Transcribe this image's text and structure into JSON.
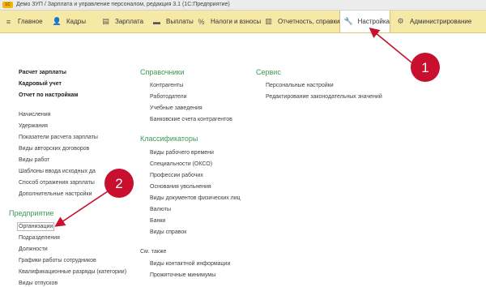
{
  "window": {
    "title": "Демо ЗУП / Зарплата и управление персоналом, редакция 3.1  (1С:Предприятие)",
    "logo": "1С"
  },
  "sections": [
    {
      "label": "Главное",
      "icon": "≡"
    },
    {
      "label": "Кадры",
      "icon": "👤"
    },
    {
      "label": "Зарплата",
      "icon": "▤"
    },
    {
      "label": "Выплаты",
      "icon": "▬"
    },
    {
      "label": "Налоги и взносы",
      "icon": "%"
    },
    {
      "label": "Отчетность, справки",
      "icon": "▥"
    },
    {
      "label": "Настройка",
      "icon": "🔧"
    },
    {
      "label": "Администрирование",
      "icon": "⚙"
    }
  ],
  "left_column": {
    "top_items": [
      "Расчет зарплаты",
      "Кадровый учет",
      "Отчет по настройкам"
    ],
    "items": [
      "Начисления",
      "Удержания",
      "Показатели расчета зарплаты",
      "Виды авторских договоров",
      "Виды работ",
      "Шаблоны ввода исходных да",
      "Способ отражения зарплаты",
      "Дополнительные настройки"
    ],
    "enterprise_group": "Предприятие",
    "enterprise_items": [
      "Организации",
      "Подразделения",
      "Должности",
      "Графики работы сотрудников",
      "Квалификационные разряды (категории)",
      "Виды отпусков"
    ]
  },
  "middle_column": {
    "directories_group": "Справочники",
    "directories_items": [
      "Контрагенты",
      "Работодатели",
      "Учебные заведения",
      "Банковские счета контрагентов"
    ],
    "classifiers_group": "Классификаторы",
    "classifiers_items": [
      "Виды рабочего времени",
      "Специальности (ОКСО)",
      "Профессии рабочих",
      "Основания увольнения",
      "Виды документов физических лиц",
      "Валюты",
      "Банки",
      "Виды справок"
    ],
    "see_also_label": "См. также",
    "see_also_items": [
      "Виды контактной информации",
      "Прожиточные минимумы"
    ]
  },
  "right_column": {
    "service_group": "Сервис",
    "service_items": [
      "Персональные настройки",
      "Редактирование законодательных значений"
    ]
  },
  "annotations": {
    "badge1": "1",
    "badge2": "2",
    "color": "#c8102e"
  }
}
